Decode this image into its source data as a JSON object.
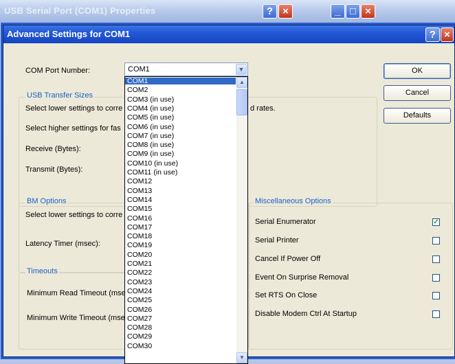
{
  "parent_window": {
    "title": "USB Serial Port (COM1) Properties",
    "help": "?",
    "close": "×",
    "minimize": "_",
    "maximize": "□"
  },
  "dialog": {
    "title": "Advanced Settings for COM1",
    "help": "?",
    "close": "×",
    "com_port_label": "COM Port Number:",
    "com_port_value": "COM1",
    "usb_group": "USB Transfer Sizes",
    "usb_desc1": "Select lower settings to corre",
    "usb_desc1_tail": "d rates.",
    "usb_desc2": "Select higher settings for fas",
    "receive_label": "Receive (Bytes):",
    "transmit_label": "Transmit (Bytes):",
    "bm_group": "BM Options",
    "bm_desc": "Select lower settings to corre",
    "latency_label": "Latency Timer (msec):",
    "timeouts_group": "Timeouts",
    "min_read_label": "Minimum Read Timeout (mse",
    "min_write_label": "Minimum Write Timeout (mse",
    "misc_group": "Miscellaneous Options",
    "misc_options": [
      {
        "label": "Serial Enumerator",
        "checked": "✓"
      },
      {
        "label": "Serial Printer",
        "checked": ""
      },
      {
        "label": "Cancel If Power Off",
        "checked": ""
      },
      {
        "label": "Event On Surprise Removal",
        "checked": ""
      },
      {
        "label": "Set RTS On Close",
        "checked": ""
      },
      {
        "label": "Disable Modem Ctrl At Startup",
        "checked": ""
      }
    ],
    "buttons": {
      "ok": "OK",
      "cancel": "Cancel",
      "defaults": "Defaults"
    }
  },
  "dropdown": {
    "items": [
      "COM1",
      "COM2",
      "COM3 (in use)",
      "COM4 (in use)",
      "COM5 (in use)",
      "COM6 (in use)",
      "COM7 (in use)",
      "COM8 (in use)",
      "COM9 (in use)",
      "COM10 (in use)",
      "COM11 (in use)",
      "COM12",
      "COM13",
      "COM14",
      "COM15",
      "COM16",
      "COM17",
      "COM18",
      "COM19",
      "COM20",
      "COM21",
      "COM22",
      "COM23",
      "COM24",
      "COM25",
      "COM26",
      "COM27",
      "COM28",
      "COM29",
      "COM30"
    ],
    "selected_index": 0,
    "scroll_up": "▲",
    "scroll_down": "▼"
  }
}
